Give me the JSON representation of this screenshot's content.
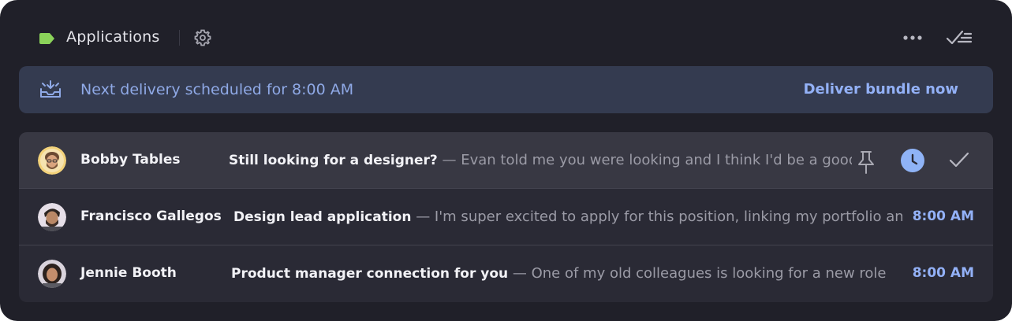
{
  "header": {
    "title": "Applications",
    "label_color": "#8bd35a",
    "label_icon": "label-tag-icon",
    "settings_icon": "gear-icon",
    "more_icon": "more-horizontal-icon",
    "done_all_icon": "done-all-icon"
  },
  "banner": {
    "icon": "inbox-delivery-icon",
    "text": "Next delivery scheduled for 8:00 AM",
    "action": "Deliver bundle now"
  },
  "emails": [
    {
      "sender": "Bobby Tables",
      "subject": "Still looking for a designer?",
      "snippet": "Evan told me you were looking and I think I'd be a good...",
      "time": "",
      "hovered": true,
      "actions": [
        "pin-icon",
        "snooze-clock-icon",
        "check-icon"
      ]
    },
    {
      "sender": "Francisco Gallegos",
      "subject": "Design lead application",
      "snippet": "I'm super excited to apply for this position, linking my portfolio and...",
      "time": "8:00 AM",
      "hovered": false
    },
    {
      "sender": "Jennie Booth",
      "subject": "Product manager connection for you",
      "snippet": "One of my old colleagues is looking for a new role i...",
      "time": "8:00 AM",
      "hovered": false
    }
  ],
  "dash": "—"
}
